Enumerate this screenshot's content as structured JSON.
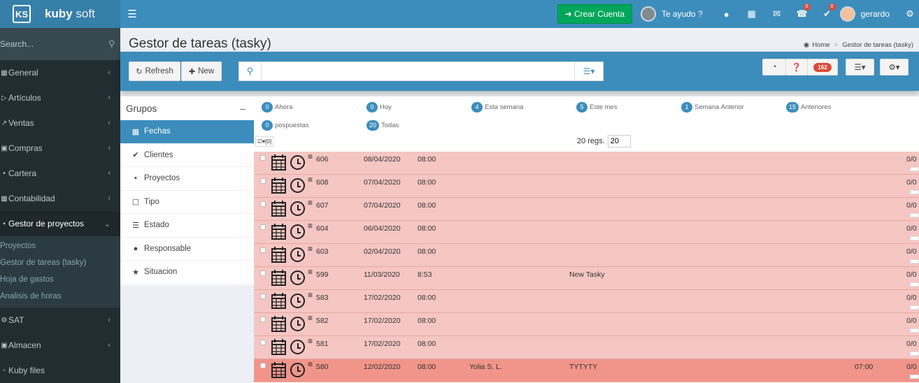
{
  "sidebar": {
    "logo_mark": "KS",
    "brand_bold": "kuby",
    "brand_light": "soft",
    "search_placeholder": "Search...",
    "items": [
      {
        "label": "General",
        "icon": "dashboard-icon"
      },
      {
        "label": "Artículos",
        "icon": "tag-icon"
      },
      {
        "label": "Ventas",
        "icon": "arrow-icon"
      },
      {
        "label": "Compras",
        "icon": "truck-icon"
      },
      {
        "label": "Cartera",
        "icon": "wallet-icon"
      },
      {
        "label": "Contabilidad",
        "icon": "calculator-icon"
      },
      {
        "label": "Gestor de proyectos",
        "icon": "sitemap-icon"
      },
      {
        "label": "SAT",
        "icon": "wrench-icon"
      },
      {
        "label": "Almacen",
        "icon": "box-icon"
      },
      {
        "label": "Kuby files",
        "icon": "file-icon"
      }
    ],
    "submenu": [
      "Proyectos",
      "Gestor de tareas (tasky)",
      "Hoja de gastos",
      "Analisis de horas"
    ]
  },
  "navbar": {
    "crear_cuenta": "Crear Cuenta",
    "te_ayudo": "Te ayudo ?",
    "bell_count": "0",
    "check_count": "0",
    "user": "gerardo"
  },
  "header": {
    "title": "Gestor de tareas (tasky)",
    "breadcrumb_home": "Home",
    "breadcrumb_current": "Gestor de tareas (tasky)"
  },
  "toolbar": {
    "refresh": "Refresh",
    "new": "New",
    "search_value": "",
    "badge": "162"
  },
  "groups": {
    "title": "Grupos",
    "items": [
      "Fechas",
      "Clientes",
      "Proyectos",
      "Tipo",
      "Estado",
      "Responsable",
      "Situacion"
    ]
  },
  "filters": [
    {
      "count": "0",
      "label": "Ahora"
    },
    {
      "count": "0",
      "label": "Hoy"
    },
    {
      "count": "4",
      "label": "Esta semana"
    },
    {
      "count": "5",
      "label": "Este mes"
    },
    {
      "count": "1",
      "label": "Semana Anterior"
    },
    {
      "count": "15",
      "label": "Anteriores"
    },
    {
      "count": "0",
      "label": "pospuestas"
    },
    {
      "count": "20",
      "label": "Todas"
    }
  ],
  "selection": "[0]",
  "regs_label": "20 regs.",
  "regs_value": "20",
  "rows": [
    {
      "id": "606",
      "date": "08/04/2020",
      "time": "08:00",
      "client": "",
      "title": "",
      "duration": "",
      "progress": "0/0",
      "hot": false
    },
    {
      "id": "608",
      "date": "07/04/2020",
      "time": "08:00",
      "client": "",
      "title": "",
      "duration": "",
      "progress": "0/0",
      "hot": false
    },
    {
      "id": "607",
      "date": "07/04/2020",
      "time": "08:00",
      "client": "",
      "title": "",
      "duration": "",
      "progress": "0/0",
      "hot": false
    },
    {
      "id": "604",
      "date": "06/04/2020",
      "time": "08:00",
      "client": "",
      "title": "",
      "duration": "",
      "progress": "0/0",
      "hot": false
    },
    {
      "id": "603",
      "date": "02/04/2020",
      "time": "08:00",
      "client": "",
      "title": "",
      "duration": "",
      "progress": "0/0",
      "hot": false
    },
    {
      "id": "599",
      "date": "11/03/2020",
      "time": "8:53",
      "client": "",
      "title": "New Tasky",
      "duration": "",
      "progress": "0/0",
      "hot": false
    },
    {
      "id": "583",
      "date": "17/02/2020",
      "time": "08:00",
      "client": "",
      "title": "",
      "duration": "",
      "progress": "0/0",
      "hot": false
    },
    {
      "id": "582",
      "date": "17/02/2020",
      "time": "08:00",
      "client": "",
      "title": "",
      "duration": "",
      "progress": "0/0",
      "hot": false
    },
    {
      "id": "581",
      "date": "17/02/2020",
      "time": "08:00",
      "client": "",
      "title": "",
      "duration": "",
      "progress": "0/0",
      "hot": false
    },
    {
      "id": "580",
      "date": "12/02/2020",
      "time": "08:00",
      "client": "Yolia S. L.",
      "title": "TYTYTY",
      "duration": "07:00",
      "progress": "0/0",
      "hot": true
    }
  ],
  "colors": {
    "primary": "#3c8dbc",
    "sidebar": "#222d32",
    "success": "#00a65a",
    "row": "#f5c6c3",
    "row_hot": "#f1958a"
  }
}
